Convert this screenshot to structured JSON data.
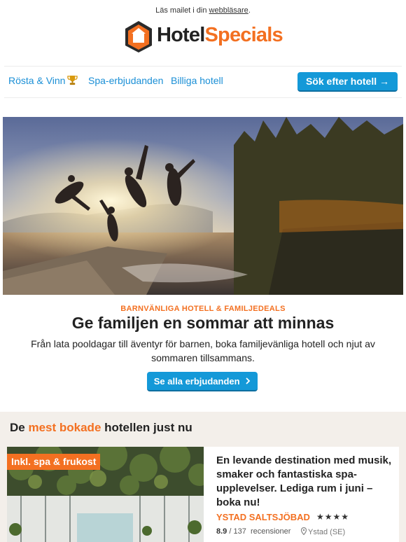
{
  "preheader": {
    "text": "Läs mailet i din ",
    "link": "webbläsare",
    "suffix": "."
  },
  "logo": {
    "word1": "Hotel",
    "word2": "Specials",
    "icon": "house-logo-icon"
  },
  "nav": {
    "items": [
      {
        "label": "Rösta & Vinn",
        "icon": "trophy-icon"
      },
      {
        "label": "Spa-erbjudanden"
      },
      {
        "label": "Billiga hotell"
      }
    ],
    "search_button": "Sök efter hotell →"
  },
  "hero": {
    "eyebrow": "BARNVÄNLIGA HOTELL & FAMILJEDEALS",
    "headline": "Ge familjen en sommar att minnas",
    "body": "Från lata pooldagar till äventyr för barnen, boka familjevänliga hotell och njut av sommaren tillsammans.",
    "cta": "Se alla erbjudanden",
    "cta_icon": "chevron-right-icon"
  },
  "section": {
    "title_prefix": "De ",
    "title_highlight": "mest bokade",
    "title_suffix": " hotellen just nu"
  },
  "hotel_card": {
    "badge": "Inkl. spa & frukost",
    "title": "En levande destination med musik, smaker och fantastiska spa-upplevelser. Lediga rum i juni – boka nu!",
    "hotel_name": "YSTAD SALTSJÖBAD",
    "stars": "★★★★",
    "star_count": 4,
    "rating_score": "8.9",
    "rating_sep": " / ",
    "review_count": "137",
    "reviews_label": "recensioner",
    "location": "Ystad (SE)",
    "location_icon": "map-pin-icon"
  },
  "colors": {
    "accent_orange": "#f37021",
    "link_blue": "#1a8fd6",
    "button_blue": "#1499d8",
    "section_bg": "#f3efea"
  }
}
